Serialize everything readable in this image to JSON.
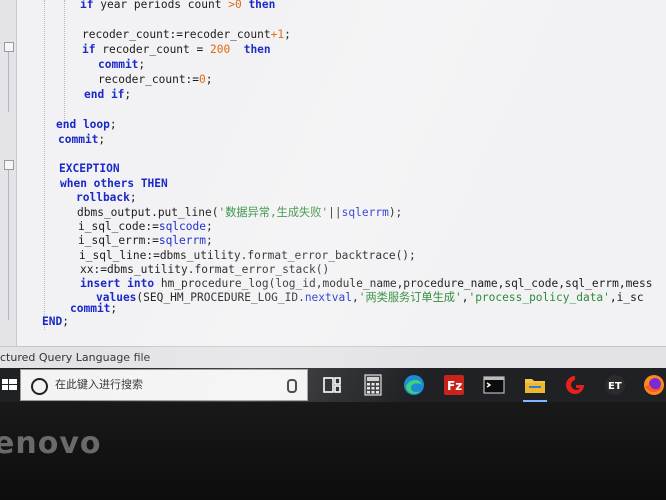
{
  "editor": {
    "lines": [
      {
        "indent": 80,
        "tokens": [
          [
            "kw",
            "if"
          ],
          [
            "plain",
            " year periods count "
          ],
          [
            "num",
            ">0"
          ],
          [
            "plain",
            " "
          ],
          [
            "kw",
            "then"
          ]
        ]
      },
      {
        "indent": 82,
        "tokens": [
          [
            "plain",
            "recoder_count:=recoder_count"
          ],
          [
            "num",
            "+1"
          ],
          [
            "plain",
            ";"
          ]
        ]
      },
      {
        "indent": 82,
        "tokens": [
          [
            "kw",
            "if"
          ],
          [
            "plain",
            " recoder_count = "
          ],
          [
            "num",
            "200"
          ],
          [
            "plain",
            "  "
          ],
          [
            "kw",
            "then"
          ]
        ]
      },
      {
        "indent": 98,
        "tokens": [
          [
            "kw",
            "commit"
          ],
          [
            "plain",
            ";"
          ]
        ]
      },
      {
        "indent": 98,
        "tokens": [
          [
            "plain",
            "recoder_count:="
          ],
          [
            "num",
            "0"
          ],
          [
            "plain",
            ";"
          ]
        ]
      },
      {
        "indent": 84,
        "tokens": [
          [
            "kw",
            "end if"
          ],
          [
            "plain",
            ";"
          ]
        ]
      },
      {
        "indent": 56,
        "tokens": [
          [
            "kw",
            "end loop"
          ],
          [
            "plain",
            ";"
          ]
        ]
      },
      {
        "indent": 58,
        "tokens": [
          [
            "kw",
            "commit"
          ],
          [
            "plain",
            ";"
          ]
        ]
      },
      {
        "indent": 59,
        "tokens": [
          [
            "kw",
            "EXCEPTION"
          ]
        ]
      },
      {
        "indent": 60,
        "tokens": [
          [
            "kw",
            "when others THEN"
          ]
        ]
      },
      {
        "indent": 76,
        "tokens": [
          [
            "kw",
            "rollback"
          ],
          [
            "plain",
            ";"
          ]
        ]
      },
      {
        "indent": 77,
        "tokens": [
          [
            "plain",
            "dbms_output.put_line("
          ],
          [
            "str",
            "'数据异常,生成失败'"
          ],
          [
            "plain",
            "||"
          ],
          [
            "fn",
            "sqlerrm"
          ],
          [
            "plain",
            ");"
          ]
        ]
      },
      {
        "indent": 78,
        "tokens": [
          [
            "plain",
            "i_sql_code:="
          ],
          [
            "fn",
            "sqlcode"
          ],
          [
            "plain",
            ";"
          ]
        ]
      },
      {
        "indent": 78,
        "tokens": [
          [
            "plain",
            "i_sql_errm:="
          ],
          [
            "fn",
            "sqlerrm"
          ],
          [
            "plain",
            ";"
          ]
        ]
      },
      {
        "indent": 79,
        "tokens": [
          [
            "plain",
            "i_sql_line:=dbms_utility.format_error_backtrace();"
          ]
        ]
      },
      {
        "indent": 80,
        "tokens": [
          [
            "plain",
            "xx:=dbms_utility.format_error_stack()"
          ]
        ]
      },
      {
        "indent": 80,
        "tokens": [
          [
            "kw",
            "insert into"
          ],
          [
            "plain",
            " hm_procedure_log(log_id,module_name,procedure_name,sql_code,sql_errm,mess"
          ]
        ]
      },
      {
        "indent": 96,
        "tokens": [
          [
            "kw",
            "values"
          ],
          [
            "plain",
            "(SEQ_HM_PROCEDURE_LOG_ID."
          ],
          [
            "fn",
            "nextval"
          ],
          [
            "plain",
            ","
          ],
          [
            "str",
            "'两类服务订单生成'"
          ],
          [
            "plain",
            ","
          ],
          [
            "str",
            "'process_policy_data'"
          ],
          [
            "plain",
            ",i_sc"
          ]
        ]
      },
      {
        "indent": 70,
        "tokens": [
          [
            "kw",
            "commit"
          ],
          [
            "plain",
            ";"
          ]
        ]
      },
      {
        "indent": 42,
        "tokens": [
          [
            "kw",
            "END"
          ],
          [
            "plain",
            ";"
          ]
        ]
      }
    ]
  },
  "status_bar": {
    "file_type": "ctured Query Language file"
  },
  "taskbar": {
    "search_placeholder": "在此键入进行搜索",
    "icons": [
      "windows-start-icon",
      "search-icon",
      "microphone-icon",
      "task-view-icon",
      "calculator-icon",
      "edge-icon",
      "filezilla-icon",
      "terminal-icon",
      "file-explorer-icon",
      "red-app-icon",
      "et-app-icon",
      "firefox-icon"
    ]
  },
  "monitor": {
    "brand": "enovo"
  }
}
